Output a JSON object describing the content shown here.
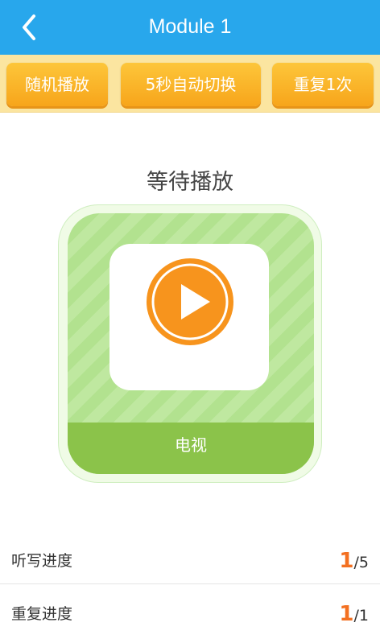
{
  "header": {
    "title": "Module 1",
    "back_icon": "chevron-left-icon"
  },
  "toolbar": {
    "random_label": "随机播放",
    "auto_switch_label": "5秒自动切换",
    "repeat_label": "重复1次"
  },
  "player": {
    "status": "等待播放",
    "word_label": "电视",
    "play_icon": "play-icon"
  },
  "progress": {
    "dictation_label": "听写进度",
    "dictation_current": "1",
    "dictation_total": "/5",
    "repeat_label": "重复进度",
    "repeat_current": "1",
    "repeat_total": "/1"
  },
  "colors": {
    "header": "#28a7ec",
    "toolbar_bg": "#fbe5a0",
    "button": "#f7a51b",
    "card_green": "#8bc34a",
    "accent": "#f37021"
  }
}
